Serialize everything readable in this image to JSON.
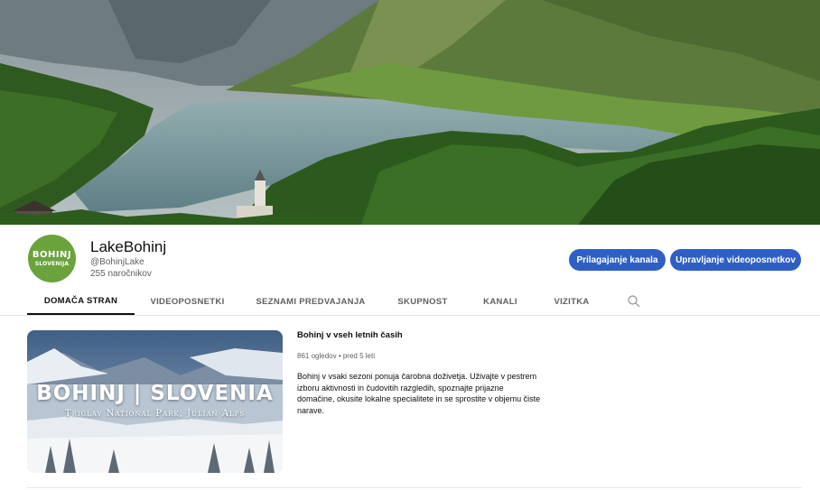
{
  "channel": {
    "avatar_line1": "BOHINJ",
    "avatar_line2": "SLOVENIJA",
    "name": "LakeBohinj",
    "handle": "@BohinjLake",
    "subscribers": "255 naročnikov",
    "customize_button": "Prilagajanje kanala",
    "manage_button": "Upravljanje videoposnetkov"
  },
  "tabs": [
    {
      "label": "DOMAČA STRAN",
      "active": true
    },
    {
      "label": "VIDEOPOSNETKI",
      "active": false
    },
    {
      "label": "SEZNAMI PREDVAJANJA",
      "active": false
    },
    {
      "label": "SKUPNOST",
      "active": false
    },
    {
      "label": "KANALI",
      "active": false
    },
    {
      "label": "VIZITKA",
      "active": false
    }
  ],
  "featured_video": {
    "thumbnail_title": "BOHINJ | SLOVENIA",
    "thumbnail_subtitle": "Triglav National Park, Julian Alps",
    "title": "Bohinj v vseh letnih časih",
    "meta": "861 ogledov • pred 5 leti",
    "description": "Bohinj v vsaki sezoni ponuja čarobna doživetja. Uživajte v pestrem izboru aktivnosti in čudovitih razgledih, spoznajte prijazne domačine, okusite lokalne specialitete in se sprostite v objemu čiste narave."
  },
  "colors": {
    "primary_button": "#2f5fc4",
    "avatar_bg": "#6aa33c",
    "text_primary": "#0f0f0f",
    "text_secondary": "#606060"
  },
  "icons": {
    "search": "search-icon"
  }
}
